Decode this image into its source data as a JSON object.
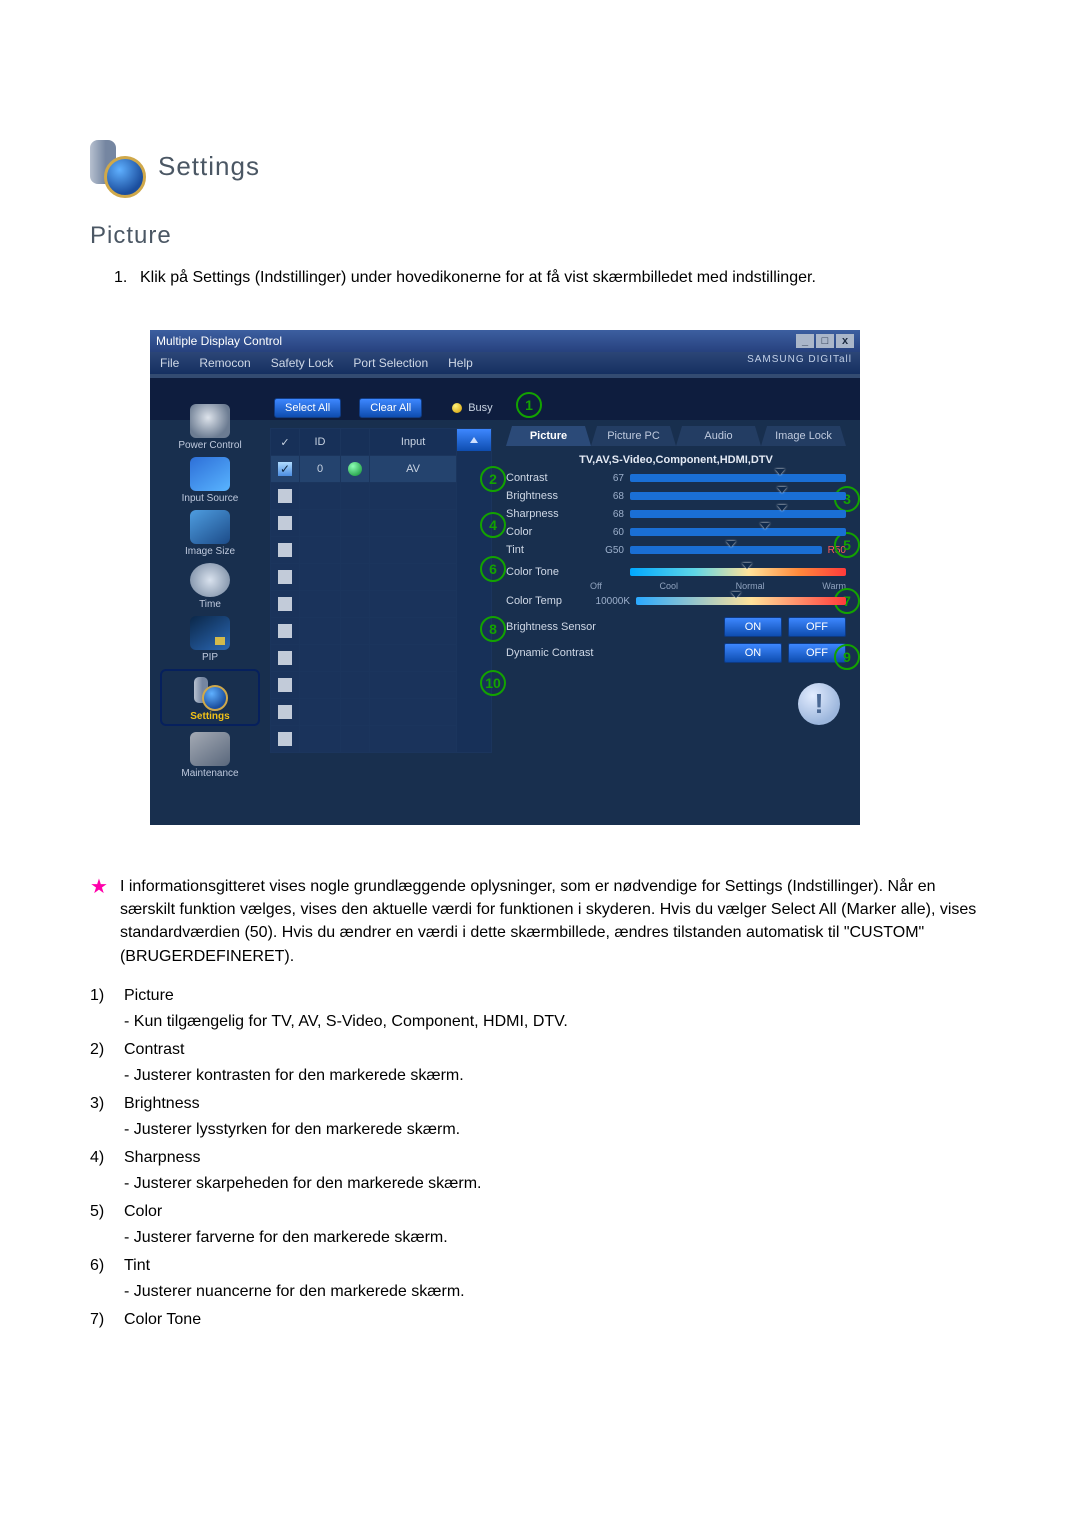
{
  "doc": {
    "title": "Settings",
    "section": "Picture",
    "step1": "Klik på Settings (Indstillinger) under hovedikonerne for at få vist skærmbilledet med indstillinger."
  },
  "window": {
    "title": "Multiple Display Control",
    "menu": {
      "file": "File",
      "remocon": "Remocon",
      "safety": "Safety Lock",
      "port": "Port Selection",
      "help": "Help"
    },
    "brand": "SAMSUNG DIGITall",
    "buttons": {
      "select_all": "Select All",
      "clear_all": "Clear All",
      "busy": "Busy"
    },
    "sidebar": {
      "power": "Power Control",
      "input": "Input Source",
      "image": "Image Size",
      "time": "Time",
      "pip": "PIP",
      "settings": "Settings",
      "maint": "Maintenance"
    },
    "table": {
      "hdr_id": "ID",
      "hdr_input": "Input",
      "row_id": "0",
      "row_input": "AV"
    },
    "tabs": {
      "picture": "Picture",
      "picture_pc": "Picture PC",
      "audio": "Audio",
      "lock": "Image Lock"
    },
    "sub_header": "TV,AV,S-Video,Component,HDMI,DTV",
    "sliders": {
      "contrast": {
        "label": "Contrast",
        "value": "67"
      },
      "brightness": {
        "label": "Brightness",
        "value": "68"
      },
      "sharpness": {
        "label": "Sharpness",
        "value": "68"
      },
      "color": {
        "label": "Color",
        "value": "60"
      },
      "tint": {
        "label": "Tint",
        "value": "G50",
        "right": "R50"
      },
      "color_tone": {
        "label": "Color Tone"
      },
      "color_temp": {
        "label": "Color Temp",
        "value": "10000K"
      }
    },
    "tone_labels": {
      "off": "Off",
      "cool": "Cool",
      "normal": "Normal",
      "warm": "Warm"
    },
    "rows": {
      "brightness_sensor": "Brightness Sensor",
      "dynamic_contrast": "Dynamic Contrast",
      "on": "ON",
      "off": "OFF"
    },
    "callouts": {
      "c1": "1",
      "c2": "2",
      "c3": "3",
      "c4": "4",
      "c5": "5",
      "c6": "6",
      "c7": "7",
      "c8": "8",
      "c9": "9",
      "c10": "10"
    }
  },
  "notes": {
    "intro": "I informationsgitteret vises nogle grundlæggende oplysninger, som er nødvendige for Settings (Indstillinger). Når en særskilt funktion vælges, vises den aktuelle værdi for funktionen i skyderen. Hvis du vælger Select All (Marker alle), vises standardværdien (50). Hvis du ændrer en værdi i dette skærmbillede, ændres tilstanden automatisk til \"CUSTOM\" (BRUGERDEFINERET).",
    "n1_title": "Picture",
    "n1_desc": "- Kun tilgængelig for TV, AV, S-Video, Component, HDMI, DTV.",
    "n2_title": "Contrast",
    "n2_desc": "- Justerer kontrasten for den markerede skærm.",
    "n3_title": "Brightness",
    "n3_desc": "- Justerer lysstyrken for den markerede skærm.",
    "n4_title": "Sharpness",
    "n4_desc": "- Justerer skarpeheden for den markerede skærm.",
    "n5_title": "Color",
    "n5_desc": "- Justerer farverne for den markerede skærm.",
    "n6_title": "Tint",
    "n6_desc": "- Justerer nuancerne for den markerede skærm.",
    "n7_title": "Color Tone",
    "labels": {
      "n1": "1)",
      "n2": "2)",
      "n3": "3)",
      "n4": "4)",
      "n5": "5)",
      "n6": "6)",
      "n7": "7)"
    }
  },
  "winbtns": {
    "min": "_",
    "max": "□",
    "close": "x"
  },
  "step1_num": "1."
}
